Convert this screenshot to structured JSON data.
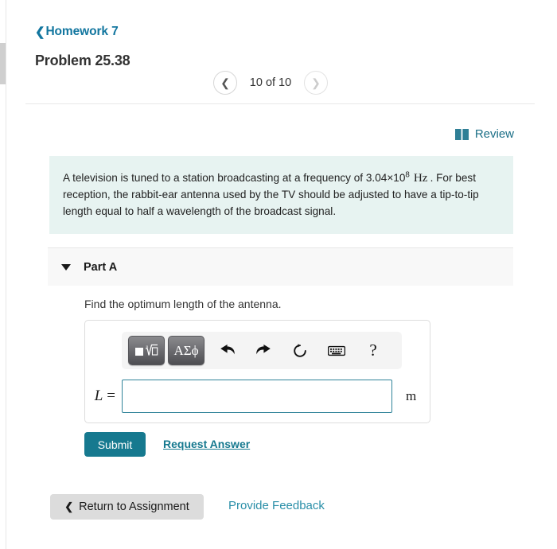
{
  "window": {
    "colors": {
      "teal": "#16798f",
      "link_teal": "#2a8fa8",
      "breadcrumb_teal": "#12769f",
      "statement_bg": "#e7f3f1",
      "input_border": "#2f8399",
      "part_header_bg": "#f8f8f8"
    }
  },
  "header": {
    "breadcrumb_icon": "chevron-left-icon",
    "breadcrumb_label": "Homework 7",
    "problem_title": "Problem 25.38"
  },
  "pager": {
    "prev_icon": "chevron-left-icon",
    "next_icon": "chevron-right-icon",
    "label": "10 of 10",
    "current": 10,
    "total": 10,
    "prev_enabled": true,
    "next_enabled": false
  },
  "review": {
    "icon": "book-icon",
    "label": "Review"
  },
  "statement": {
    "text_part1": "A television is tuned to a station broadcasting at a frequency of 3.04×10",
    "exponent": "8",
    "unit": "Hz",
    "text_part2": ". For best reception, the rabbit-ear antenna used by the TV should be adjusted to have a tip-to-tip length equal to half a wavelength of the broadcast signal."
  },
  "part": {
    "caret_icon": "caret-down-icon",
    "label": "Part A",
    "prompt": "Find the optimum length of the antenna."
  },
  "math_toolbar": {
    "buttons": [
      {
        "name": "math-template-button",
        "icon": "nth-root-icon",
        "label": ""
      },
      {
        "name": "greek-symbols-button",
        "icon": "greek-icon",
        "label": "ΑΣϕ"
      },
      {
        "name": "undo-button",
        "icon": "undo-arrow-icon",
        "label": ""
      },
      {
        "name": "redo-button",
        "icon": "redo-arrow-icon",
        "label": ""
      },
      {
        "name": "reset-button",
        "icon": "refresh-icon",
        "label": ""
      },
      {
        "name": "keyboard-button",
        "icon": "keyboard-icon",
        "label": ""
      },
      {
        "name": "help-button",
        "icon": "question-mark-icon",
        "label": "?"
      }
    ]
  },
  "answer": {
    "lhs_variable": "L",
    "lhs_equals": "=",
    "value": "",
    "placeholder": "",
    "unit": "m"
  },
  "actions": {
    "submit_label": "Submit",
    "request_answer_label": "Request Answer"
  },
  "footer": {
    "return_icon": "chevron-left-icon",
    "return_label": "Return to Assignment",
    "feedback_label": "Provide Feedback"
  }
}
